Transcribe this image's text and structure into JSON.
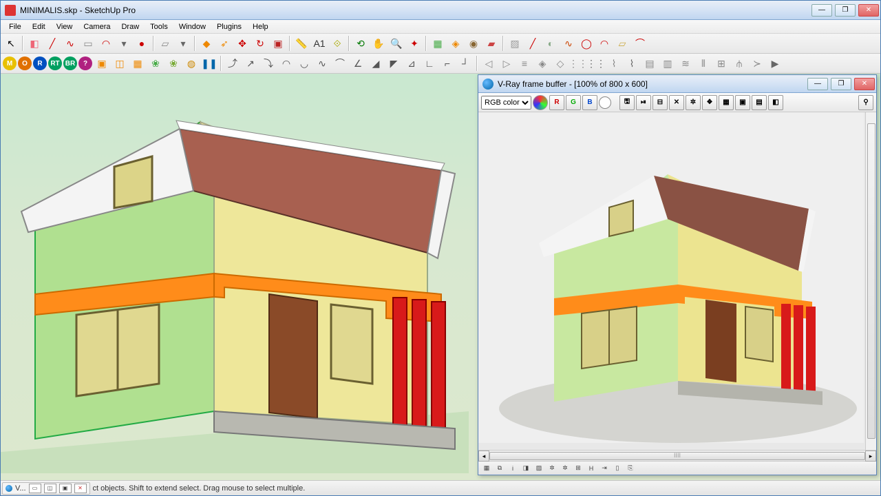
{
  "window": {
    "title": "MINIMALIS.skp - SketchUp Pro",
    "controls": {
      "min": "—",
      "max": "❐",
      "close": "✕"
    }
  },
  "menu": [
    "File",
    "Edit",
    "View",
    "Camera",
    "Draw",
    "Tools",
    "Window",
    "Plugins",
    "Help"
  ],
  "toolbar_row1": [
    {
      "n": "select",
      "g": "↖",
      "c": "#000"
    },
    {
      "sep": true
    },
    {
      "n": "eraser",
      "g": "◧",
      "c": "#e67"
    },
    {
      "n": "line",
      "g": "╱",
      "c": "#c00"
    },
    {
      "n": "freehand",
      "g": "∿",
      "c": "#c00"
    },
    {
      "n": "rect",
      "g": "▭",
      "c": "#888"
    },
    {
      "n": "arc",
      "g": "◠",
      "c": "#c00"
    },
    {
      "n": "menu-arrow",
      "g": "▾",
      "c": "#666"
    },
    {
      "n": "circle",
      "g": "●",
      "c": "#c00"
    },
    {
      "sep": true
    },
    {
      "n": "surface",
      "g": "▱",
      "c": "#888"
    },
    {
      "n": "dropdown",
      "g": "▾",
      "c": "#666"
    },
    {
      "sep": true
    },
    {
      "n": "paint",
      "g": "◆",
      "c": "#e80"
    },
    {
      "n": "follow",
      "g": "➶",
      "c": "#e80"
    },
    {
      "n": "move",
      "g": "✥",
      "c": "#c00"
    },
    {
      "n": "rotate",
      "g": "↻",
      "c": "#c00"
    },
    {
      "n": "scale",
      "g": "▣",
      "c": "#b22"
    },
    {
      "sep": true
    },
    {
      "n": "tape",
      "g": "📏",
      "c": "#aa0"
    },
    {
      "n": "text",
      "g": "A1",
      "c": "#333"
    },
    {
      "n": "dim",
      "g": "⟐",
      "c": "#aa0"
    },
    {
      "sep": true
    },
    {
      "n": "orbit",
      "g": "⟲",
      "c": "#070"
    },
    {
      "n": "pan",
      "g": "✋",
      "c": "#ea5"
    },
    {
      "n": "zoom",
      "g": "🔍",
      "c": "#06a"
    },
    {
      "n": "zoom-ext",
      "g": "✦",
      "c": "#c00"
    },
    {
      "sep": true
    },
    {
      "n": "map",
      "g": "▦",
      "c": "#4a4"
    },
    {
      "n": "layers",
      "g": "◈",
      "c": "#e80"
    },
    {
      "n": "outliner",
      "g": "◉",
      "c": "#863"
    },
    {
      "n": "section",
      "g": "▰",
      "c": "#c44"
    },
    {
      "sep": true
    },
    {
      "n": "xray",
      "g": "▨",
      "c": "#999"
    },
    {
      "n": "edge",
      "g": "╱",
      "c": "#c00"
    },
    {
      "n": "back",
      "g": "◐",
      "c": "#8a8"
    },
    {
      "n": "style1",
      "g": "∿",
      "c": "#c40"
    },
    {
      "n": "style2",
      "g": "◯",
      "c": "#c00"
    },
    {
      "n": "style3",
      "g": "◠",
      "c": "#c00"
    },
    {
      "n": "style4",
      "g": "▱",
      "c": "#ca4"
    },
    {
      "n": "style5",
      "g": "⌒",
      "c": "#c00"
    }
  ],
  "toolbar_row2_badges": [
    {
      "n": "M",
      "bg": "#e8c000"
    },
    {
      "n": "O",
      "bg": "#e07000"
    },
    {
      "n": "R",
      "bg": "#0050c0"
    },
    {
      "n": "RT",
      "bg": "#00a060"
    },
    {
      "n": "BR",
      "bg": "#00a060"
    },
    {
      "n": "?",
      "bg": "#b02080"
    }
  ],
  "toolbar_row2_rest": [
    {
      "n": "comp1",
      "g": "▣",
      "c": "#e80"
    },
    {
      "n": "comp2",
      "g": "◫",
      "c": "#e80"
    },
    {
      "n": "comp3",
      "g": "▦",
      "c": "#e80"
    },
    {
      "n": "tree",
      "g": "❀",
      "c": "#4a4"
    },
    {
      "n": "tree2",
      "g": "❀",
      "c": "#7a3"
    },
    {
      "n": "globe",
      "g": "◍",
      "c": "#c80"
    },
    {
      "n": "pause",
      "g": "❚❚",
      "c": "#06a"
    },
    {
      "sep": true
    },
    {
      "n": "c1",
      "g": "⤴",
      "c": "#555"
    },
    {
      "n": "c2",
      "g": "↗",
      "c": "#555"
    },
    {
      "n": "c3",
      "g": "⤵",
      "c": "#555"
    },
    {
      "n": "c4",
      "g": "◠",
      "c": "#555"
    },
    {
      "n": "c5",
      "g": "◡",
      "c": "#555"
    },
    {
      "n": "c6",
      "g": "∿",
      "c": "#555"
    },
    {
      "n": "c7",
      "g": "⌒",
      "c": "#555"
    },
    {
      "n": "c8",
      "g": "∠",
      "c": "#555"
    },
    {
      "n": "c9",
      "g": "◢",
      "c": "#555"
    },
    {
      "n": "c10",
      "g": "◤",
      "c": "#555"
    },
    {
      "n": "c11",
      "g": "⊿",
      "c": "#555"
    },
    {
      "n": "c12",
      "g": "∟",
      "c": "#555"
    },
    {
      "n": "c13",
      "g": "⌐",
      "c": "#555"
    },
    {
      "n": "c14",
      "g": "┘",
      "c": "#555"
    },
    {
      "sep": true
    },
    {
      "n": "e1",
      "g": "◁",
      "c": "#888"
    },
    {
      "n": "e2",
      "g": "▷",
      "c": "#888"
    },
    {
      "n": "e3",
      "g": "≡",
      "c": "#888"
    },
    {
      "n": "e4",
      "g": "◈",
      "c": "#888"
    },
    {
      "n": "e5",
      "g": "◇",
      "c": "#888"
    },
    {
      "n": "e6",
      "g": "⋮⋮",
      "c": "#888"
    },
    {
      "n": "e7",
      "g": "⋮⋮",
      "c": "#666"
    },
    {
      "n": "e8",
      "g": "⌇",
      "c": "#888"
    },
    {
      "n": "e9",
      "g": "⌇",
      "c": "#666"
    },
    {
      "n": "e10",
      "g": "▤",
      "c": "#888"
    },
    {
      "n": "e11",
      "g": "▥",
      "c": "#888"
    },
    {
      "n": "e12",
      "g": "≋",
      "c": "#888"
    },
    {
      "n": "e13",
      "g": "⫴",
      "c": "#888"
    },
    {
      "n": "e14",
      "g": "⊞",
      "c": "#888"
    },
    {
      "n": "e15",
      "g": "⫛",
      "c": "#888"
    },
    {
      "n": "e16",
      "g": "≻",
      "c": "#888"
    },
    {
      "n": "e17",
      "g": "▶",
      "c": "#666"
    }
  ],
  "status": {
    "panel_label": "V...",
    "hint": "   ct objects. Shift to extend select. Drag mouse to select multiple."
  },
  "vray": {
    "title": "V-Ray frame buffer - [100% of 800 x 600]",
    "channel": "RGB color",
    "rgb": {
      "r": "R",
      "g": "G",
      "b": "B"
    },
    "scroll_label": "IIII"
  },
  "vray_bottom": [
    "▦",
    "⧉",
    "i",
    "◨",
    "▨",
    "✲",
    "✲",
    "⊞",
    "H",
    "⇥",
    "▯",
    "⎘"
  ]
}
